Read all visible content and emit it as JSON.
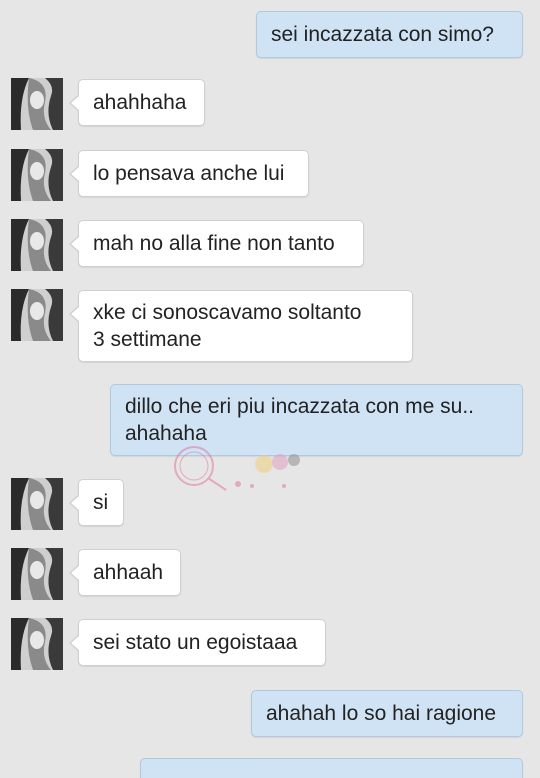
{
  "conversation": {
    "messages": [
      {
        "side": "out",
        "text": "sei incazzata con simo?"
      },
      {
        "side": "in",
        "text": "ahahhaha"
      },
      {
        "side": "in",
        "text": "lo pensava anche lui"
      },
      {
        "side": "in",
        "text": "mah no alla fine non tanto"
      },
      {
        "side": "in",
        "text": "xke ci sonoscavamo soltanto\n3 settimane"
      },
      {
        "side": "out",
        "text": "dillo che eri piu incazzata con me su..\nahahaha"
      },
      {
        "side": "in",
        "text": "si"
      },
      {
        "side": "in",
        "text": "ahhaah"
      },
      {
        "side": "in",
        "text": "sei stato un egoistaaa"
      },
      {
        "side": "out",
        "text": "ahahah lo so hai ragione"
      }
    ]
  },
  "colors": {
    "background": "#e6e6e6",
    "incoming_bubble": "#ffffff",
    "outgoing_bubble": "#cfe3f5"
  },
  "icons": {
    "contact_avatar": "contact-avatar-photo",
    "watermark": "watermark-logo"
  }
}
